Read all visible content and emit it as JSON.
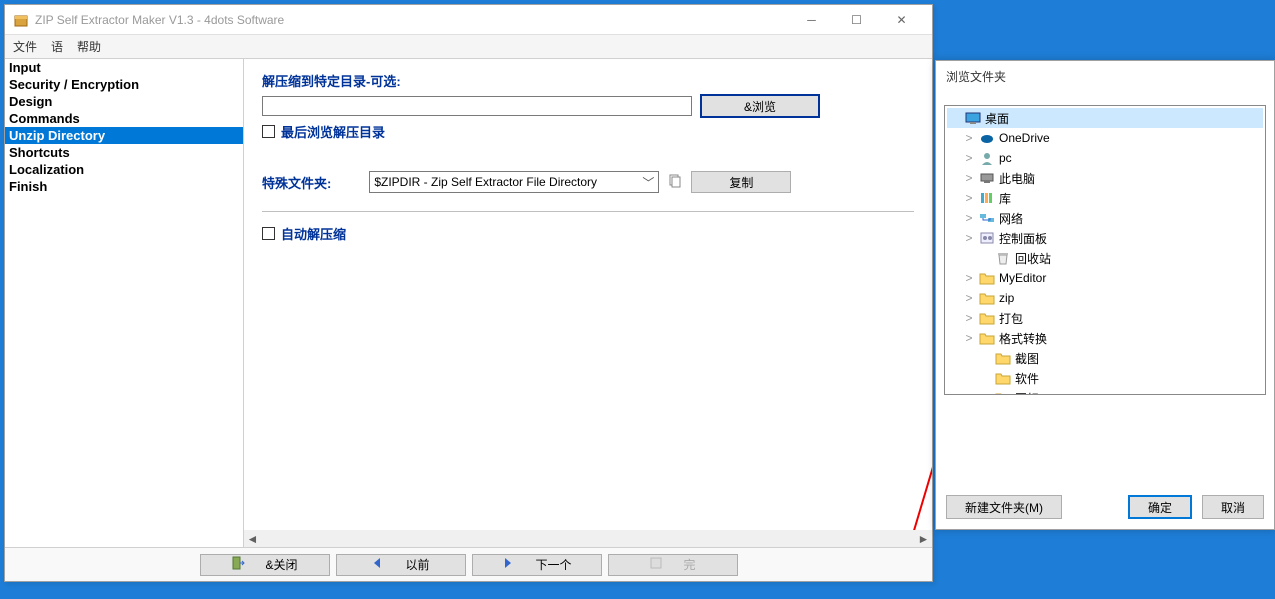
{
  "window": {
    "title": "ZIP Self Extractor Maker V1.3 - 4dots Software"
  },
  "menu": {
    "file": "文件",
    "lang": "语",
    "help": "帮助"
  },
  "sidebar": {
    "items": [
      {
        "label": "Input"
      },
      {
        "label": "Security / Encryption"
      },
      {
        "label": "Design"
      },
      {
        "label": "Commands"
      },
      {
        "label": "Unzip Directory"
      },
      {
        "label": "Shortcuts"
      },
      {
        "label": "Localization"
      },
      {
        "label": "Finish"
      }
    ],
    "selected_index": 4
  },
  "panel": {
    "dir_label": "解压缩到特定目录-可选:",
    "dir_value": "",
    "browse_btn": "&浏览",
    "check_open_after": "最后浏览解压目录",
    "special_folder_label": "特殊文件夹:",
    "special_folder_value": "$ZIPDIR - Zip Self Extractor File Directory",
    "copy_btn": "复制",
    "auto_unzip_label": "自动解压缩"
  },
  "bottom": {
    "close": "&关闭",
    "prev": "以前",
    "next": "下一个",
    "finish": "完"
  },
  "dialog": {
    "title": "浏览文件夹",
    "tree": [
      {
        "label": "桌面",
        "depth": 0,
        "expand": "",
        "icon": "desktop",
        "selected": true
      },
      {
        "label": "OneDrive",
        "depth": 1,
        "expand": ">",
        "icon": "onedrive"
      },
      {
        "label": "pc",
        "depth": 1,
        "expand": ">",
        "icon": "user"
      },
      {
        "label": "此电脑",
        "depth": 1,
        "expand": ">",
        "icon": "pc"
      },
      {
        "label": "库",
        "depth": 1,
        "expand": ">",
        "icon": "lib"
      },
      {
        "label": "网络",
        "depth": 1,
        "expand": ">",
        "icon": "net"
      },
      {
        "label": "控制面板",
        "depth": 1,
        "expand": ">",
        "icon": "cpl"
      },
      {
        "label": "回收站",
        "depth": 2,
        "expand": "",
        "icon": "bin"
      },
      {
        "label": "MyEditor",
        "depth": 1,
        "expand": ">",
        "icon": "folder"
      },
      {
        "label": "zip",
        "depth": 1,
        "expand": ">",
        "icon": "folder"
      },
      {
        "label": "打包",
        "depth": 1,
        "expand": ">",
        "icon": "folder"
      },
      {
        "label": "格式转换",
        "depth": 1,
        "expand": ">",
        "icon": "folder"
      },
      {
        "label": "截图",
        "depth": 2,
        "expand": "",
        "icon": "folder"
      },
      {
        "label": "软件",
        "depth": 2,
        "expand": "",
        "icon": "folder"
      },
      {
        "label": "图标",
        "depth": 2,
        "expand": "",
        "icon": "folder"
      }
    ],
    "new_folder": "新建文件夹(M)",
    "ok": "确定",
    "cancel": "取消"
  }
}
